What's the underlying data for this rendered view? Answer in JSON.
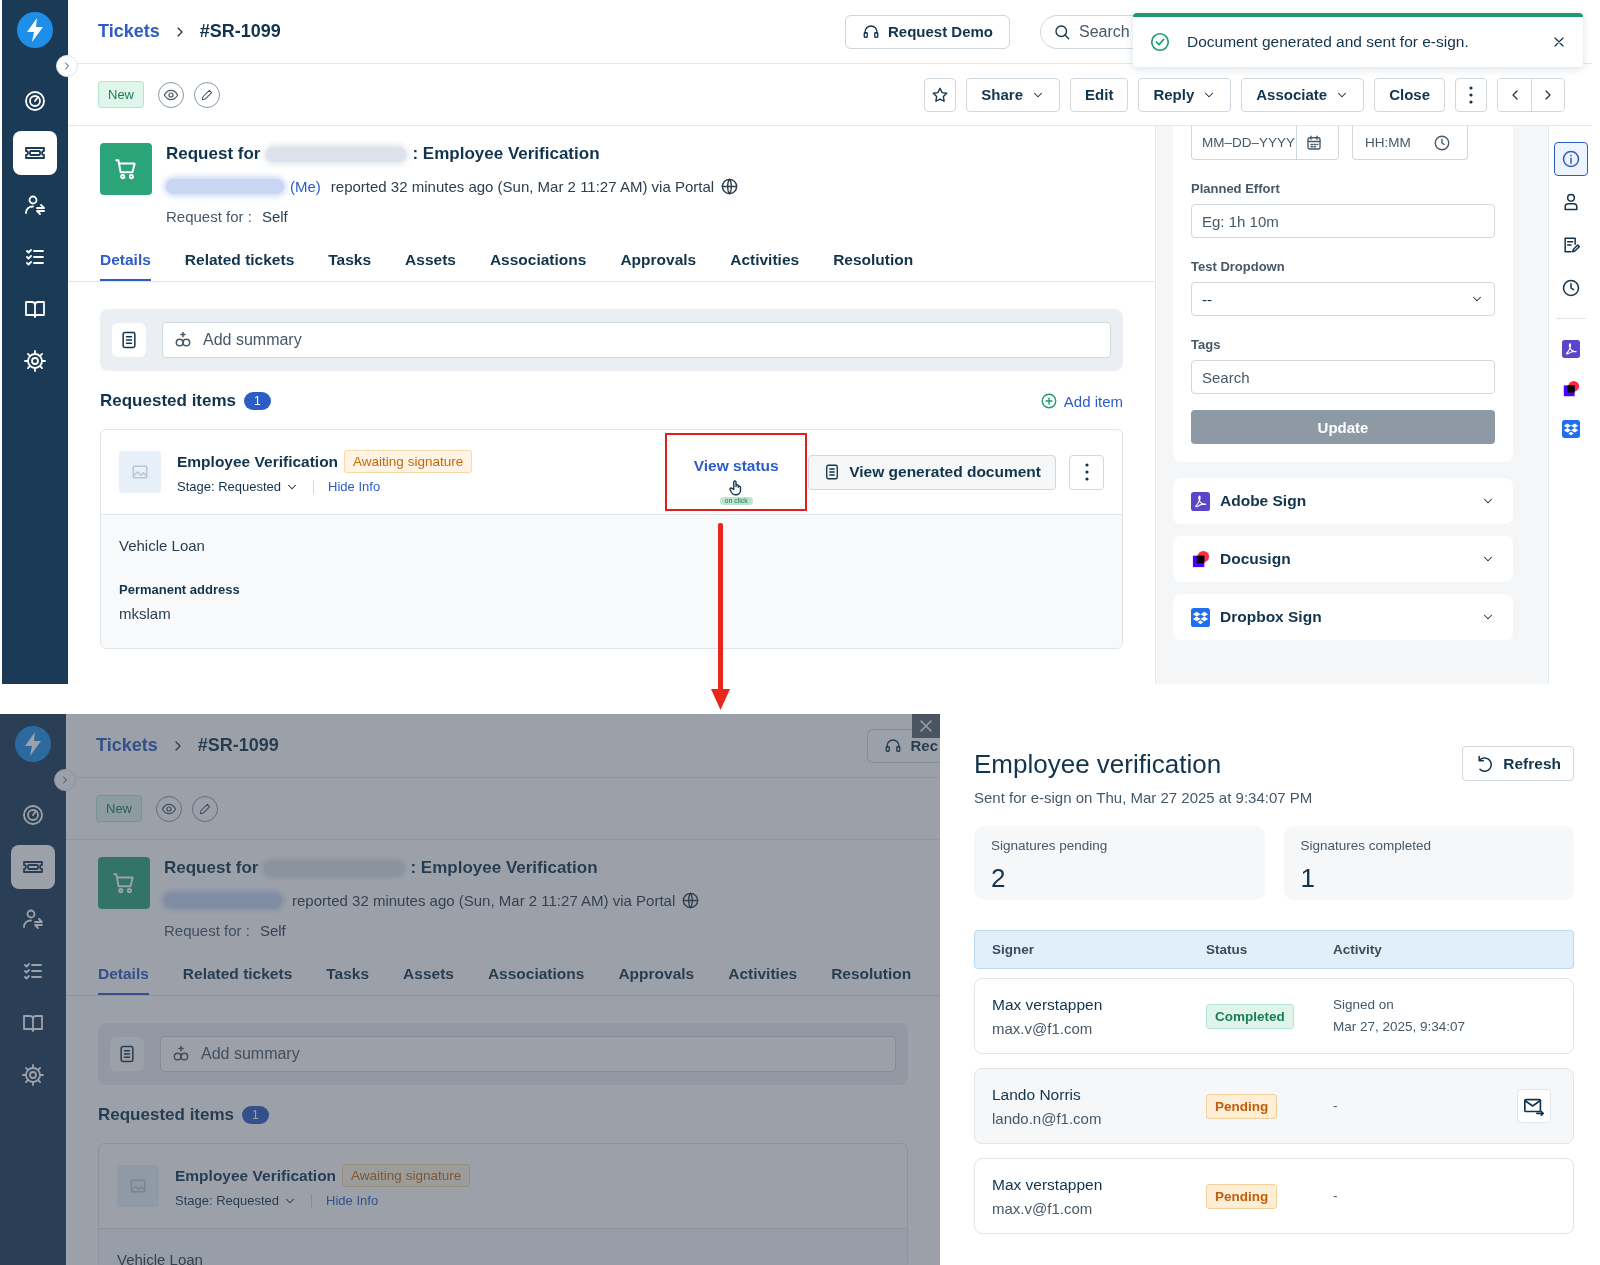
{
  "top_screen": {
    "sidebar": [
      {
        "kind": "dashboard",
        "selected": false
      },
      {
        "kind": "tickets",
        "selected": true
      },
      {
        "kind": "contacts",
        "selected": false
      },
      {
        "kind": "tasks",
        "selected": false
      },
      {
        "kind": "solutions",
        "selected": false
      },
      {
        "kind": "settings",
        "selected": false
      }
    ],
    "breadcrumb": {
      "parent": "Tickets",
      "current": "#SR-1099"
    },
    "header_buttons": [
      {
        "label": "Request Demo"
      }
    ],
    "search": {
      "placeholder": "Search"
    },
    "toast": {
      "message": "Document generated and sent for e-sign."
    },
    "status": "New",
    "toolbar": [
      {
        "kind": "star"
      },
      {
        "kind": "menu",
        "label": "Share"
      },
      {
        "kind": "plain",
        "label": "Edit"
      },
      {
        "kind": "menu",
        "label": "Reply"
      },
      {
        "kind": "menu",
        "label": "Associate"
      },
      {
        "kind": "plain",
        "label": "Close"
      },
      {
        "kind": "more"
      },
      {
        "kind": "pager"
      }
    ],
    "ticket": {
      "title_start": "Request for",
      "title_end": ": Employee Verification",
      "requester_suffix": "(Me)",
      "reported": "reported 32 minutes ago (Sun, Mar 2 11:27 AM) via Portal",
      "request_for_label": "Request for :",
      "request_for_value": "Self"
    },
    "tabs": [
      {
        "label": "Details",
        "selected": true
      },
      {
        "label": "Related tickets",
        "selected": false
      },
      {
        "label": "Tasks",
        "selected": false
      },
      {
        "label": "Assets",
        "selected": false
      },
      {
        "label": "Associations",
        "selected": false
      },
      {
        "label": "Approvals",
        "selected": false
      },
      {
        "label": "Activities",
        "selected": false
      },
      {
        "label": "Resolution",
        "selected": false
      }
    ],
    "summary": {
      "placeholder": "Add summary"
    },
    "requested_items": {
      "title": "Requested items",
      "count": "1",
      "add_label": "Add item"
    },
    "item": {
      "name": "Employee Verification",
      "badge": "Awaiting signature",
      "stage": "Stage: Requested",
      "toggle": "Hide Info",
      "actions": {
        "view_status": "View status",
        "cursor_hint": "on click",
        "view_document": "View generated document"
      },
      "fields": [
        {
          "value": "Vehicle Loan"
        },
        {
          "label": "Permanent address",
          "value": "mkslam"
        }
      ]
    },
    "properties": {
      "date_placeholder": "MM–DD–YYYY",
      "time_placeholder": "HH:MM",
      "fields": [
        {
          "kind": "text",
          "label": "Planned Effort",
          "placeholder": "Eg: 1h 10m"
        },
        {
          "kind": "select",
          "label": "Test Dropdown",
          "value": "--"
        },
        {
          "kind": "text",
          "label": "Tags",
          "placeholder": "Search"
        }
      ],
      "submit": {
        "label": "Update",
        "disabled": true
      }
    },
    "integrations": [
      {
        "kind": "adobe",
        "label": "Adobe Sign",
        "expanded": false
      },
      {
        "kind": "docusign",
        "label": "Docusign",
        "expanded": false
      },
      {
        "kind": "dropbox",
        "label": "Dropbox Sign",
        "expanded": false
      }
    ],
    "rail": {
      "tools": [
        {
          "kind": "info",
          "selected": true
        },
        {
          "kind": "contact",
          "selected": false
        },
        {
          "kind": "notes",
          "selected": false
        },
        {
          "kind": "timer",
          "selected": false
        }
      ],
      "apps": [
        {
          "kind": "adobe"
        },
        {
          "kind": "docusign"
        },
        {
          "kind": "dropbox"
        }
      ]
    }
  },
  "bottom_screen": {
    "sidebar": [
      {
        "kind": "dashboard",
        "selected": false
      },
      {
        "kind": "tickets",
        "selected": true
      },
      {
        "kind": "contacts",
        "selected": false
      },
      {
        "kind": "tasks",
        "selected": false
      },
      {
        "kind": "solutions",
        "selected": false
      },
      {
        "kind": "settings",
        "selected": false
      }
    ],
    "breadcrumb": {
      "parent": "Tickets",
      "current": "#SR-1099"
    },
    "header_buttons": [
      {
        "label": "Rec"
      }
    ],
    "status": "New",
    "ticket": {
      "title_start": "Request for",
      "title_end": ": Employee Verification",
      "reported": "reported 32 minutes ago (Sun, Mar 2 11:27 AM) via Portal",
      "request_for_label": "Request for :",
      "request_for_value": "Self"
    },
    "tabs": [
      {
        "label": "Details",
        "selected": true
      },
      {
        "label": "Related tickets",
        "selected": false
      },
      {
        "label": "Tasks",
        "selected": false
      },
      {
        "label": "Assets",
        "selected": false
      },
      {
        "label": "Associations",
        "selected": false
      },
      {
        "label": "Approvals",
        "selected": false
      },
      {
        "label": "Activities",
        "selected": false
      },
      {
        "label": "Resolution",
        "selected": false
      }
    ],
    "summary": {
      "placeholder": "Add summary"
    },
    "requested_items": {
      "title": "Requested items",
      "count": "1"
    },
    "item": {
      "name": "Employee Verification",
      "badge": "Awaiting signature",
      "stage": "Stage: Requested",
      "toggle": "Hide Info",
      "fields": [
        {
          "value": "Vehicle Loan"
        }
      ]
    }
  },
  "drawer": {
    "title": "Employee verification",
    "subtitle": "Sent for e-sign on Thu, Mar 27 2025 at 9:34:07 PM",
    "refresh": "Refresh",
    "stats": [
      {
        "label": "Signatures pending",
        "value": "2"
      },
      {
        "label": "Signatures completed",
        "value": "1"
      }
    ],
    "columns": [
      "Signer",
      "Status",
      "Activity"
    ],
    "signers": [
      {
        "name": "Max verstappen",
        "email": "max.v@f1.com",
        "status": "Completed",
        "kind": "completed",
        "activity": [
          "Signed on",
          "Mar 27, 2025, 9:34:07"
        ],
        "hovered": false
      },
      {
        "name": "Lando Norris",
        "email": "lando.n@f1.com",
        "status": "Pending",
        "kind": "pending",
        "activity": [
          "-"
        ],
        "hovered": true
      },
      {
        "name": "Max verstappen",
        "email": "max.v@f1.com",
        "status": "Pending",
        "kind": "pending",
        "activity": [
          "-"
        ],
        "hovered": false
      }
    ]
  }
}
